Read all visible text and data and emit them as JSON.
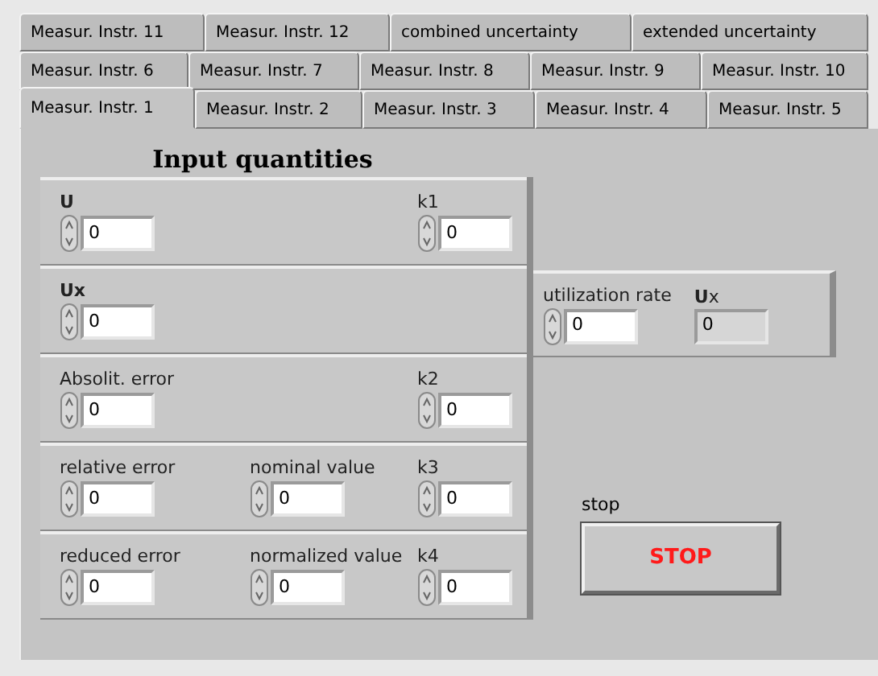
{
  "tab_rows": [
    [
      {
        "label": "Measur. Instr. 11",
        "selected": false
      },
      {
        "label": "Measur. Instr. 12",
        "selected": false
      },
      {
        "label": "combined uncertainty",
        "selected": false
      },
      {
        "label": "extended uncertainty",
        "selected": false
      }
    ],
    [
      {
        "label": "Measur. Instr. 6",
        "selected": false
      },
      {
        "label": "Measur. Instr. 7",
        "selected": false
      },
      {
        "label": "Measur. Instr. 8",
        "selected": false
      },
      {
        "label": "Measur. Instr. 9",
        "selected": false
      },
      {
        "label": "Measur. Instr. 10",
        "selected": false
      }
    ],
    [
      {
        "label": "Measur. Instr. 1",
        "selected": true
      },
      {
        "label": "Measur. Instr. 2",
        "selected": false
      },
      {
        "label": "Measur. Instr. 3",
        "selected": false
      },
      {
        "label": "Measur. Instr. 4",
        "selected": false
      },
      {
        "label": "Measur. Instr. 5",
        "selected": false
      }
    ]
  ],
  "input_quantities": {
    "title": "Input quantities",
    "sections": [
      {
        "left": {
          "label": "U",
          "bold": true,
          "value": "0",
          "kind": "control"
        },
        "right": {
          "label": "k1",
          "value": "0",
          "kind": "control"
        }
      },
      {
        "left": {
          "label": "Ux",
          "bold": true,
          "value": "0",
          "kind": "control"
        }
      },
      {
        "left": {
          "label": "Absolit. error",
          "value": "0",
          "kind": "control"
        },
        "right": {
          "label": "k2",
          "value": "0",
          "kind": "control"
        }
      },
      {
        "left": {
          "label": "relative error",
          "value": "0",
          "kind": "control"
        },
        "middle": {
          "label": "nominal value",
          "value": "0",
          "kind": "control"
        },
        "right": {
          "label": "k3",
          "value": "0",
          "kind": "control"
        }
      },
      {
        "left": {
          "label": "reduced error",
          "value": "0",
          "kind": "control"
        },
        "middle": {
          "label": "normalized value",
          "value": "0",
          "kind": "control"
        },
        "right": {
          "label": "k4",
          "value": "0",
          "kind": "control"
        }
      }
    ]
  },
  "utilization": {
    "fields": [
      {
        "label": "utilization rate",
        "value": "0",
        "kind": "control"
      },
      {
        "label": "**U**x",
        "value": "0",
        "kind": "indicator"
      }
    ]
  },
  "stop": {
    "label": "stop",
    "button": "STOP"
  }
}
